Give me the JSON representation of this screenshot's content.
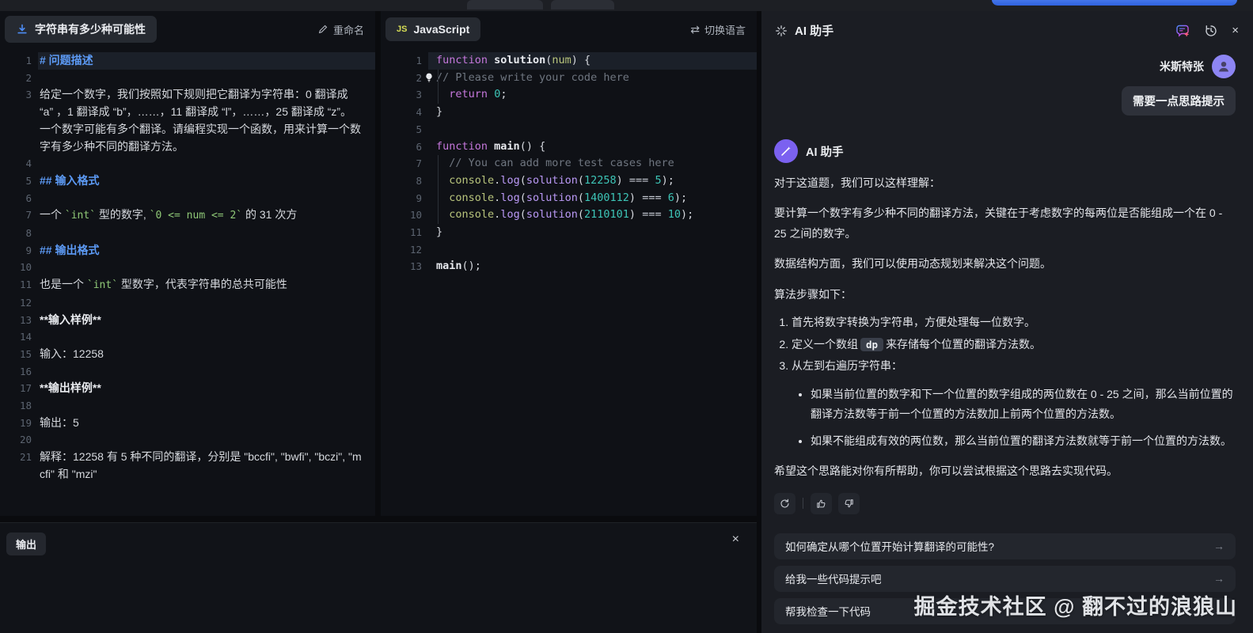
{
  "icons": {
    "arrow_right": "→",
    "close": "×",
    "switch": "⇄"
  },
  "problem_panel": {
    "title": "字符串有多少种可能性",
    "rename_label": "重命名",
    "lines": [
      {
        "n": "1",
        "hl": true,
        "segs": [
          {
            "t": "# 问题描述",
            "c": "h"
          }
        ]
      },
      {
        "n": "2",
        "segs": []
      },
      {
        "n": "3",
        "segs": [
          {
            "t": "给定一个数字，我们按照如下规则把它翻译为字符串：0 翻译成 “a” ，1 翻译成 “b”，……，11 翻译成 “l”，……，25 翻译成 “z”。一个数字可能有多个翻译。请编程实现一个函数，用来计算一个数字有多少种不同的翻译方法。"
          }
        ]
      },
      {
        "n": "4",
        "segs": []
      },
      {
        "n": "5",
        "segs": [
          {
            "t": "## 输入格式",
            "c": "h"
          }
        ]
      },
      {
        "n": "6",
        "segs": []
      },
      {
        "n": "7",
        "segs": [
          {
            "t": "一个 "
          },
          {
            "t": "`int`",
            "c": "code"
          },
          {
            "t": " 型的数字, "
          },
          {
            "t": "`0 <= num <= 2`",
            "c": "code"
          },
          {
            "t": " 的 31 次方"
          }
        ]
      },
      {
        "n": "8",
        "segs": []
      },
      {
        "n": "9",
        "segs": [
          {
            "t": "## 输出格式",
            "c": "h"
          }
        ]
      },
      {
        "n": "10",
        "segs": []
      },
      {
        "n": "11",
        "segs": [
          {
            "t": "也是一个 "
          },
          {
            "t": "`int`",
            "c": "code"
          },
          {
            "t": " 型数字，代表字符串的总共可能性"
          }
        ]
      },
      {
        "n": "12",
        "segs": []
      },
      {
        "n": "13",
        "segs": [
          {
            "t": "**输入样例**",
            "c": "b"
          }
        ]
      },
      {
        "n": "14",
        "segs": []
      },
      {
        "n": "15",
        "segs": [
          {
            "t": "输入：12258"
          }
        ]
      },
      {
        "n": "16",
        "segs": []
      },
      {
        "n": "17",
        "segs": [
          {
            "t": "**输出样例**",
            "c": "b"
          }
        ]
      },
      {
        "n": "18",
        "segs": []
      },
      {
        "n": "19",
        "segs": [
          {
            "t": "输出：5"
          }
        ]
      },
      {
        "n": "20",
        "segs": []
      },
      {
        "n": "21",
        "segs": [
          {
            "t": "解释：12258 有 5 种不同的翻译，分别是 \"bccfi\", \"bwfi\", \"bczi\", \"mcfi\" 和 \"mzi\""
          }
        ]
      }
    ]
  },
  "editor_panel": {
    "language_badge": "JS",
    "language_label": "JavaScript",
    "switch_language_label": "切换语言",
    "code_lines": [
      {
        "n": "1",
        "hl": true,
        "segs": [
          {
            "t": "function",
            "c": "kw"
          },
          {
            "t": " "
          },
          {
            "t": "solution",
            "c": "fn"
          },
          {
            "t": "("
          },
          {
            "t": "num",
            "c": "pm"
          },
          {
            "t": ") {"
          }
        ]
      },
      {
        "n": "2",
        "guide": true,
        "bulb": true,
        "segs": [
          {
            "t": "// Please write your code here",
            "c": "cmt"
          }
        ]
      },
      {
        "n": "3",
        "guide": true,
        "segs": [
          {
            "t": "  "
          },
          {
            "t": "return",
            "c": "kw"
          },
          {
            "t": " "
          },
          {
            "t": "0",
            "c": "num"
          },
          {
            "t": ";"
          }
        ]
      },
      {
        "n": "4",
        "segs": [
          {
            "t": "}"
          }
        ]
      },
      {
        "n": "5",
        "segs": []
      },
      {
        "n": "6",
        "segs": [
          {
            "t": "function",
            "c": "kw"
          },
          {
            "t": " "
          },
          {
            "t": "main",
            "c": "fn"
          },
          {
            "t": "() {"
          }
        ]
      },
      {
        "n": "7",
        "guide": true,
        "segs": [
          {
            "t": "  "
          },
          {
            "t": "// You can add more test cases here",
            "c": "cmt"
          }
        ]
      },
      {
        "n": "8",
        "guide": true,
        "segs": [
          {
            "t": "  "
          },
          {
            "t": "console",
            "c": "ob"
          },
          {
            "t": "."
          },
          {
            "t": "log",
            "c": "mt"
          },
          {
            "t": "("
          },
          {
            "t": "solution",
            "c": "mt"
          },
          {
            "t": "("
          },
          {
            "t": "12258",
            "c": "num"
          },
          {
            "t": ") "
          },
          {
            "t": "===",
            "c": "op"
          },
          {
            "t": " "
          },
          {
            "t": "5",
            "c": "num"
          },
          {
            "t": ");"
          }
        ]
      },
      {
        "n": "9",
        "guide": true,
        "segs": [
          {
            "t": "  "
          },
          {
            "t": "console",
            "c": "ob"
          },
          {
            "t": "."
          },
          {
            "t": "log",
            "c": "mt"
          },
          {
            "t": "("
          },
          {
            "t": "solution",
            "c": "mt"
          },
          {
            "t": "("
          },
          {
            "t": "1400112",
            "c": "num"
          },
          {
            "t": ") "
          },
          {
            "t": "===",
            "c": "op"
          },
          {
            "t": " "
          },
          {
            "t": "6",
            "c": "num"
          },
          {
            "t": ");"
          }
        ]
      },
      {
        "n": "10",
        "guide": true,
        "segs": [
          {
            "t": "  "
          },
          {
            "t": "console",
            "c": "ob"
          },
          {
            "t": "."
          },
          {
            "t": "log",
            "c": "mt"
          },
          {
            "t": "("
          },
          {
            "t": "solution",
            "c": "mt"
          },
          {
            "t": "("
          },
          {
            "t": "2110101",
            "c": "num"
          },
          {
            "t": ") "
          },
          {
            "t": "===",
            "c": "op"
          },
          {
            "t": " "
          },
          {
            "t": "10",
            "c": "num"
          },
          {
            "t": ");"
          }
        ]
      },
      {
        "n": "11",
        "segs": [
          {
            "t": "}"
          }
        ]
      },
      {
        "n": "12",
        "segs": []
      },
      {
        "n": "13",
        "segs": [
          {
            "t": "main",
            "c": "fn"
          },
          {
            "t": "();"
          }
        ]
      }
    ]
  },
  "output_panel": {
    "title": "输出"
  },
  "ai_panel": {
    "title": "AI 助手",
    "user": {
      "name": "米斯特张",
      "message": "需要一点思路提示"
    },
    "assistant": {
      "name": "AI 助手",
      "p1": "对于这道题，我们可以这样理解：",
      "p2": "要计算一个数字有多少种不同的翻译方法，关键在于考虑数字的每两位是否能组成一个在 0 - 25 之间的数字。",
      "p3": "数据结构方面，我们可以使用动态规划来解决这个问题。",
      "p4": "算法步骤如下：",
      "steps": [
        {
          "text": "首先将数字转换为字符串，方便处理每一位数字。"
        },
        {
          "pre": "定义一个数组",
          "code": "dp",
          "post": "来存储每个位置的翻译方法数。"
        },
        {
          "text": "从左到右遍历字符串："
        }
      ],
      "bullets": [
        "如果当前位置的数字和下一个位置的数字组成的两位数在 0 - 25 之间，那么当前位置的翻译方法数等于前一个位置的方法数加上前两个位置的方法数。",
        "如果不能组成有效的两位数，那么当前位置的翻译方法数就等于前一个位置的方法数。"
      ],
      "closing": "希望这个思路能对你有所帮助，你可以尝试根据这个思路去实现代码。"
    },
    "suggestions": [
      "如何确定从哪个位置开始计算翻译的可能性?",
      "给我一些代码提示吧",
      "帮我检查一下代码"
    ],
    "watermark": "掘金技术社区 @ 翻不过的浪狼山"
  }
}
